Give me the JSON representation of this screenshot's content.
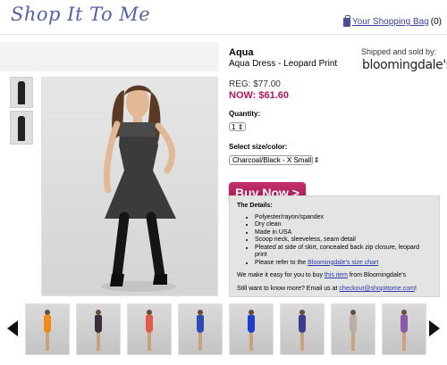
{
  "header": {
    "logo_text": "Shop It To Me",
    "bag_link": "Your Shopping Bag",
    "bag_count": "(0)"
  },
  "product": {
    "brand": "Aqua",
    "name": "Aqua Dress - Leopard Print",
    "reg_price": "REG: $77.00",
    "now_price": "NOW: $61.60",
    "quantity_label": "Quantity:",
    "quantity_value": "1",
    "size_label": "Select size/color:",
    "size_value": "Charcoal/Black - X Small",
    "buy_button": "Buy Now >",
    "seller_label": "Shipped and sold by:",
    "seller_logo": "bloomingdale's"
  },
  "details": {
    "heading": "The Details:",
    "bullets": [
      "Polyester/rayon/spandex",
      "Dry clean",
      "Made in USA",
      "Scoop neck, sleeveless, seam detail",
      "Pleated at side of skirt, concealed back zip closure, leopard print"
    ],
    "size_chart_prefix": "Please refer to the ",
    "size_chart_link": "Bloomingdale's size chart",
    "buy_note_prefix": "We make it easy for you to buy ",
    "buy_note_link": "this item",
    "buy_note_suffix": " from Bloomingdale's",
    "email_prefix": "Still want to know more? Email us at ",
    "email_link": "checkout@shopittome.com",
    "email_suffix": "!"
  },
  "colors": {
    "brand_purple": "#5560a8",
    "price_accent": "#b0185a",
    "buy_button": "#b01f5c",
    "link": "#2b37a8"
  },
  "carousel": {
    "items": [
      {
        "dress_color": "#f08a1a"
      },
      {
        "dress_color": "#3a2f3a"
      },
      {
        "dress_color": "#e25a4a"
      },
      {
        "dress_color": "#2f4ab0"
      },
      {
        "dress_color": "#1d3fd0"
      },
      {
        "dress_color": "#3a3f8a"
      },
      {
        "dress_color": "#b8b0a8"
      },
      {
        "dress_color": "#8a5aa8"
      }
    ]
  }
}
